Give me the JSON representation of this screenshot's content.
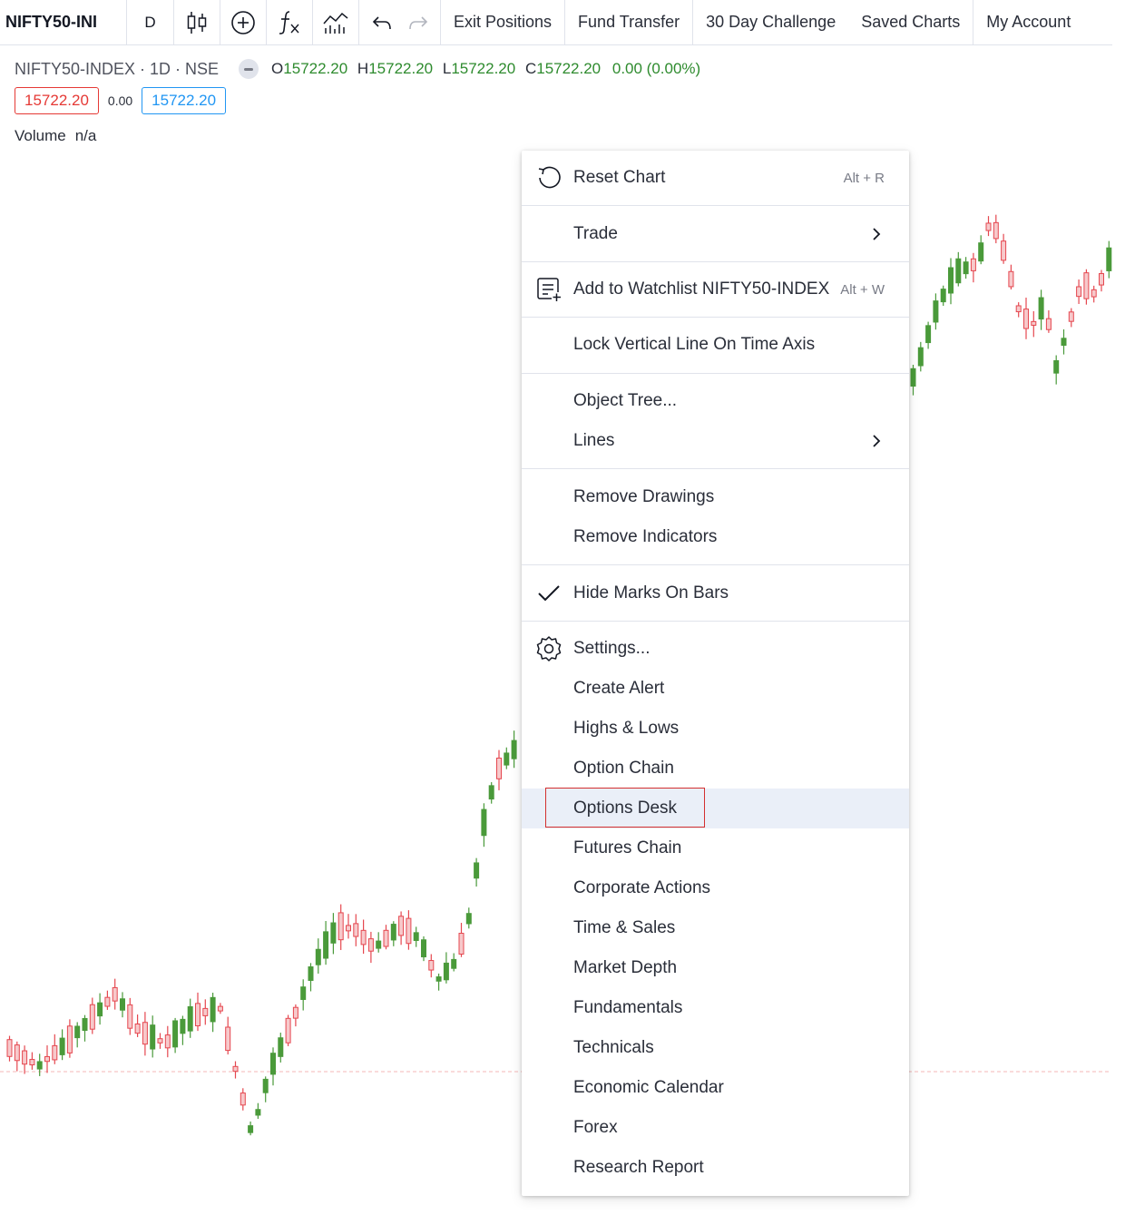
{
  "toolbar": {
    "symbol": "NIFTY50-INI",
    "interval": "D",
    "icons": [
      "candles-icon",
      "add-circle-icon",
      "fx-icon",
      "indicator-chart-icon",
      "undo-icon",
      "redo-icon"
    ],
    "buttons": [
      "Exit Positions",
      "Fund Transfer",
      "30 Day Challenge",
      "Saved Charts",
      "My Account"
    ]
  },
  "legend": {
    "symbol_line": "NIFTY50-INDEX · 1D · NSE",
    "o_label": "O",
    "o": "15722.20",
    "h_label": "H",
    "h": "15722.20",
    "l_label": "L",
    "l": "15722.20",
    "c_label": "C",
    "c": "15722.20",
    "change": "0.00 (0.00%)",
    "bid": "15722.20",
    "spread": "0.00",
    "ask": "15722.20",
    "volume_label": "Volume",
    "volume_value": "n/a"
  },
  "colors": {
    "up": "#4a9a3a",
    "down": "#e5474f",
    "bid": "#e53935",
    "ask": "#2196f3",
    "menu_highlight": "#eaeff8",
    "highlight_border": "#d32f2f"
  },
  "context_menu": {
    "items": [
      {
        "label": "Reset Chart",
        "shortcut": "Alt + R",
        "icon": "reset-icon"
      },
      {
        "label": "Trade",
        "submenu": true
      },
      {
        "label": "Add to Watchlist NIFTY50-INDEX",
        "shortcut": "Alt + W",
        "icon": "watchlist-add-icon"
      },
      {
        "label": "Lock Vertical Line On Time Axis"
      },
      {
        "label": "Object Tree..."
      },
      {
        "label": "Lines",
        "submenu": true
      },
      {
        "label": "Remove Drawings"
      },
      {
        "label": "Remove Indicators"
      },
      {
        "label": "Hide Marks On Bars",
        "checked": true,
        "icon": "checkmark-icon"
      },
      {
        "label": "Settings...",
        "icon": "gear-icon"
      },
      {
        "label": "Create Alert"
      },
      {
        "label": "Highs & Lows"
      },
      {
        "label": "Option Chain"
      },
      {
        "label": "Options Desk",
        "highlighted": true
      },
      {
        "label": "Futures Chain"
      },
      {
        "label": "Corporate Actions"
      },
      {
        "label": "Time & Sales"
      },
      {
        "label": "Market Depth"
      },
      {
        "label": "Fundamentals"
      },
      {
        "label": "Technicals"
      },
      {
        "label": "Economic Calendar"
      },
      {
        "label": "Forex"
      },
      {
        "label": "Research Report"
      }
    ]
  }
}
